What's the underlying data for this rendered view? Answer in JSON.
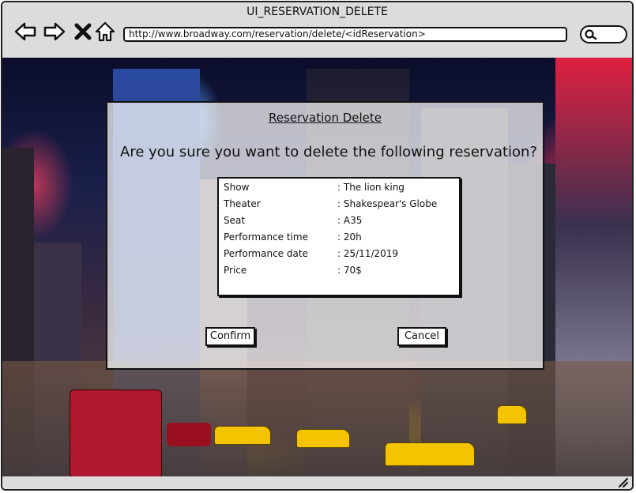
{
  "window": {
    "title": "UI_RESERVATION_DELETE"
  },
  "browser": {
    "url": "http://www.broadway.com/reservation/delete/<idReservation>",
    "icons": [
      "back-arrow-icon",
      "forward-arrow-icon",
      "close-x-icon",
      "home-icon",
      "search-icon"
    ]
  },
  "dialog": {
    "title": "Reservation Delete",
    "question": "Are you sure you want to delete the following reservation?",
    "details": [
      {
        "key": "Show",
        "value": ": The lion king"
      },
      {
        "key": "Theater",
        "value": ": Shakespear's Globe"
      },
      {
        "key": "Seat",
        "value": ": A35"
      },
      {
        "key": "Performance time",
        "value": ": 20h"
      },
      {
        "key": "Performance date",
        "value": ": 25/11/2019"
      },
      {
        "key": "Price",
        "value": ": 70$"
      }
    ],
    "confirm_label": "Confirm",
    "cancel_label": "Cancel"
  },
  "background": {
    "description_hidden": true
  }
}
